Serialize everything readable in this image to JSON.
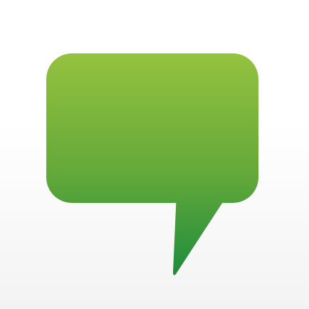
{
  "icon": {
    "name": "speech-bubble-icon",
    "gradient_top": "#95c23f",
    "gradient_mid": "#62a83a",
    "gradient_bottom": "#1e8c3c"
  },
  "background": {
    "top": "#ffffff",
    "bottom": "#f3f3f3"
  }
}
